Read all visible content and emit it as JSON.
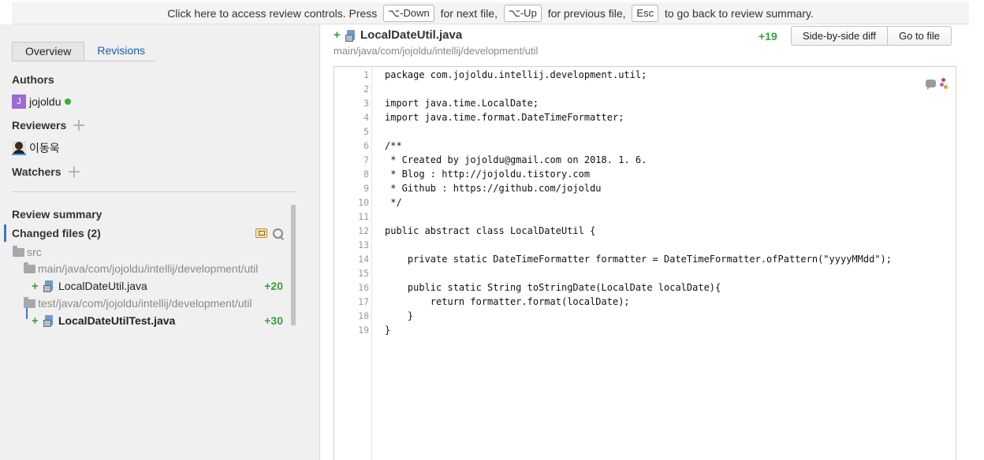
{
  "banner": {
    "text1": "Click here to access review controls. Press ",
    "key_next": "⌥-Down",
    "text2": " for next file, ",
    "key_prev": "⌥-Up",
    "text3": " for previous file, ",
    "key_esc": "Esc",
    "text4": " to go back to review summary."
  },
  "tabs": [
    {
      "label": "Overview",
      "active": true
    },
    {
      "label": "Revisions",
      "active": false
    }
  ],
  "authors": {
    "label": "Authors",
    "items": [
      {
        "initial": "J",
        "name": "jojoldu",
        "online": true
      }
    ]
  },
  "reviewers": {
    "label": "Reviewers",
    "items": [
      {
        "name": "이동욱"
      }
    ]
  },
  "watchers": {
    "label": "Watchers"
  },
  "summary": {
    "title": "Review summary",
    "changed_files_title": "Changed files (2)"
  },
  "tree": {
    "root": "src",
    "main_dir": "main/java/com/jojoldu/intellij/development/util",
    "main_file": {
      "name": "LocalDateUtil.java",
      "count": "+20"
    },
    "test_dir": "test/java/com/jojoldu/intellij/development/util",
    "test_file": {
      "name": "LocalDateUtilTest.java",
      "count": "+30"
    }
  },
  "file_header": {
    "name": "LocalDateUtil.java",
    "path": "main/java/com/jojoldu/intellij/development/util",
    "count": "+19",
    "btn_side_by_side": "Side-by-side diff",
    "btn_go_to_file": "Go to file"
  },
  "code_lines": [
    "package com.jojoldu.intellij.development.util;",
    "",
    "import java.time.LocalDate;",
    "import java.time.format.DateTimeFormatter;",
    "",
    "/**",
    " * Created by jojoldu@gmail.com on 2018. 1. 6.",
    " * Blog : http://jojoldu.tistory.com",
    " * Github : https://github.com/jojoldu",
    " */",
    "",
    "public abstract class LocalDateUtil {",
    "",
    "    private static DateTimeFormatter formatter = DateTimeFormatter.ofPattern(\"yyyyMMdd\");",
    "",
    "    public static String toStringDate(LocalDate localDate){",
    "        return formatter.format(localDate);",
    "    }",
    "}"
  ],
  "colors": {
    "accent": "#3b78c2",
    "added": "#3c9d3c",
    "link": "#1a5dab"
  }
}
